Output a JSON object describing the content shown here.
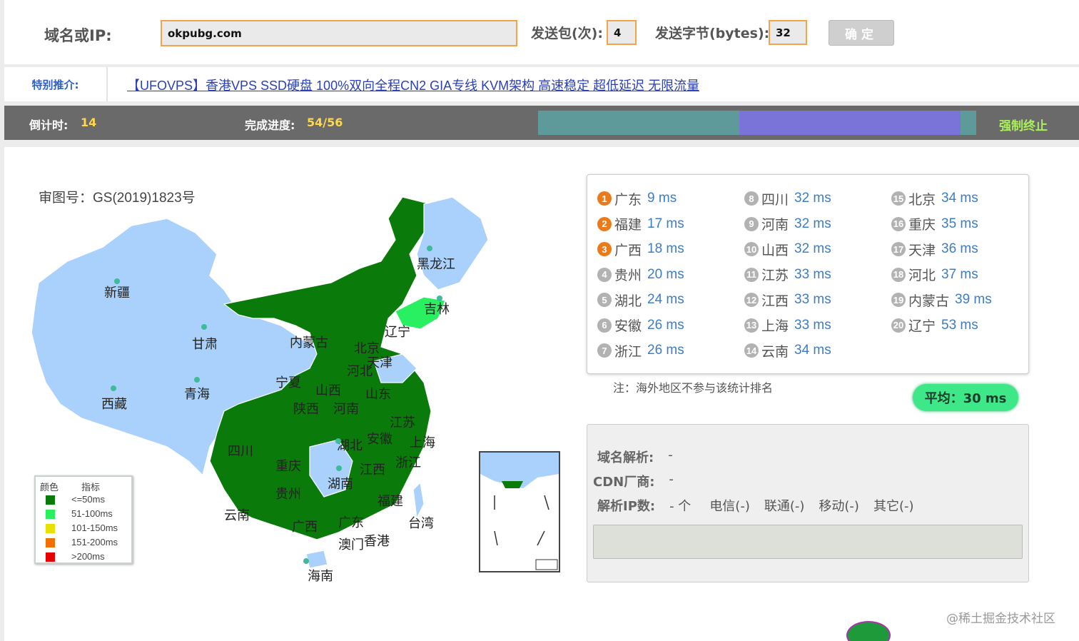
{
  "form": {
    "domain_label": "域名或IP:",
    "domain_value": "okpubg.com",
    "packets_label": "发送包(次):",
    "packets_value": "4",
    "bytes_label": "发送字节(bytes):",
    "bytes_value": "32",
    "confirm_label": "确定"
  },
  "promo": {
    "label": "特别推介:",
    "link_text": "【UFOVPS】香港VPS SSD硬盘 100%双向全程CN2 GIA专线 KVM架构 高速稳定 超低延迟 无限流量"
  },
  "status": {
    "countdown_label": "倒计时:",
    "countdown_value": "14",
    "progress_label": "完成进度:",
    "progress_value": "54/56",
    "progress_fraction": 0.964,
    "stop_label": "强制终止"
  },
  "map": {
    "review_number": "审图号：GS(2019)1823号",
    "provinces": [
      "新疆",
      "西藏",
      "青海",
      "甘肃",
      "内蒙古",
      "黑龙江",
      "吉林",
      "辽宁",
      "宁夏",
      "陕西",
      "山西",
      "河北",
      "北京",
      "天津",
      "山东",
      "河南",
      "四川",
      "重庆",
      "湖北",
      "安徽",
      "江苏",
      "上海",
      "浙江",
      "江西",
      "湖南",
      "贵州",
      "云南",
      "广西",
      "广东",
      "福建",
      "台湾",
      "澳门",
      "香港",
      "海南"
    ],
    "legend": {
      "col_color": "颜色",
      "col_index": "指标",
      "items": [
        {
          "label": "<=50ms",
          "color": "#0a7a0a"
        },
        {
          "label": "51-100ms",
          "color": "#28f060"
        },
        {
          "label": "101-150ms",
          "color": "#e8e000"
        },
        {
          "label": "151-200ms",
          "color": "#f07000"
        },
        {
          "label": ">200ms",
          "color": "#e80000"
        }
      ]
    }
  },
  "ranking": [
    {
      "rank": "1",
      "province": "广东",
      "ms": "9 ms"
    },
    {
      "rank": "2",
      "province": "福建",
      "ms": "17 ms"
    },
    {
      "rank": "3",
      "province": "广西",
      "ms": "18 ms"
    },
    {
      "rank": "4",
      "province": "贵州",
      "ms": "20 ms"
    },
    {
      "rank": "5",
      "province": "湖北",
      "ms": "24 ms"
    },
    {
      "rank": "6",
      "province": "安徽",
      "ms": "26 ms"
    },
    {
      "rank": "7",
      "province": "浙江",
      "ms": "26 ms"
    },
    {
      "rank": "8",
      "province": "四川",
      "ms": "32 ms"
    },
    {
      "rank": "9",
      "province": "河南",
      "ms": "32 ms"
    },
    {
      "rank": "10",
      "province": "山西",
      "ms": "32 ms"
    },
    {
      "rank": "11",
      "province": "江苏",
      "ms": "33 ms"
    },
    {
      "rank": "12",
      "province": "江西",
      "ms": "33 ms"
    },
    {
      "rank": "13",
      "province": "上海",
      "ms": "33 ms"
    },
    {
      "rank": "14",
      "province": "云南",
      "ms": "34 ms"
    },
    {
      "rank": "15",
      "province": "北京",
      "ms": "34 ms"
    },
    {
      "rank": "16",
      "province": "重庆",
      "ms": "35 ms"
    },
    {
      "rank": "17",
      "province": "天津",
      "ms": "36 ms"
    },
    {
      "rank": "18",
      "province": "河北",
      "ms": "37 ms"
    },
    {
      "rank": "19",
      "province": "内蒙古",
      "ms": "39 ms"
    },
    {
      "rank": "20",
      "province": "辽宁",
      "ms": "53 ms"
    }
  ],
  "note": "注：海外地区不参与该统计排名",
  "average": "平均：30 ms",
  "info": {
    "dns_label": "域名解析:",
    "dns_value": "-",
    "cdn_label": "CDN厂商:",
    "cdn_value": "-",
    "ip_count_label": "解析IP数:",
    "ip_count_value": "- 个",
    "telecom": "电信(-)",
    "unicom": "联通(-)",
    "mobile": "移动(-)",
    "other": "其它(-)"
  },
  "watermark": "@稀土掘金技术社区"
}
